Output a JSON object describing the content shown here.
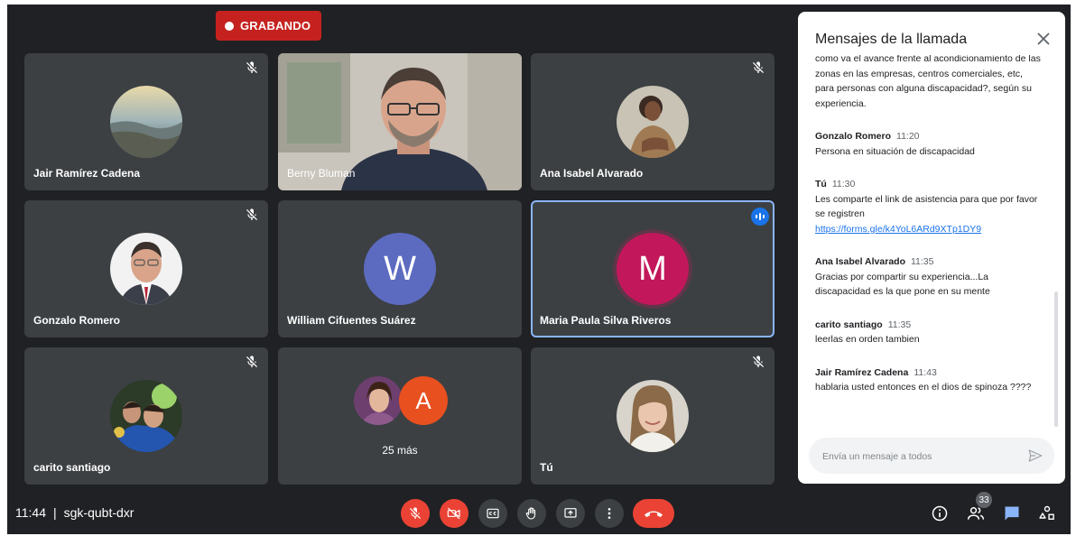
{
  "recording": {
    "label": "GRABANDO"
  },
  "tiles": [
    {
      "name": "Jair Ramírez Cadena"
    },
    {
      "name": "Berny Bluman"
    },
    {
      "name": "Ana Isabel Alvarado"
    },
    {
      "name": "Gonzalo Romero"
    },
    {
      "name": "William Cifuentes Suárez",
      "letter": "W"
    },
    {
      "name": "Maria Paula Silva Riveros",
      "letter": "M"
    },
    {
      "name": "carito santiago"
    },
    {
      "more": "25 más",
      "letter": "A"
    },
    {
      "name": "Tú"
    }
  ],
  "chat": {
    "title": "Mensajes de la llamada",
    "messages": [
      {
        "text": "como va el avance frente al acondicionamiento de las zonas en las empresas, centros comerciales, etc, para personas con alguna discapacidad?, según su experiencia."
      },
      {
        "sender": "Gonzalo Romero",
        "time": "11:20",
        "text": "Persona en situación de discapacidad"
      },
      {
        "sender": "Tú",
        "time": "11:30",
        "text": "Les comparte el link de asistencia para que por favor se registren",
        "link": "https://forms.gle/k4YoL6ARd9XTp1DY9"
      },
      {
        "sender": "Ana Isabel Alvarado",
        "time": "11:35",
        "text": "Gracias por compartir su experiencia...La discapacidad es la que pone en su mente"
      },
      {
        "sender": "carito santiago",
        "time": "11:35",
        "text": "leerlas en orden tambien"
      },
      {
        "sender": "Jair Ramírez Cadena",
        "time": "11:43",
        "text": "hablaria usted entonces en el dios de spinoza ????"
      }
    ],
    "input_placeholder": "Envía un mensaje a todos"
  },
  "meeting": {
    "time": "11:44",
    "code": "sgk-qubt-dxr"
  },
  "participants_count": "33",
  "colors": {
    "stage": "#202124",
    "tile": "#3c4043",
    "recording": "#c5221f",
    "danger": "#ea4335",
    "accent": "#1a73e8",
    "letter_w": "#5c6bc0",
    "letter_m": "#c2185b",
    "letter_a": "#e8501f"
  },
  "icons": [
    "mic-off-icon",
    "speaking-icon",
    "close-icon",
    "send-icon",
    "camera-off-icon",
    "captions-icon",
    "hand-icon",
    "present-icon",
    "more-icon",
    "hangup-icon",
    "info-icon",
    "people-icon",
    "chat-icon",
    "activities-icon"
  ]
}
